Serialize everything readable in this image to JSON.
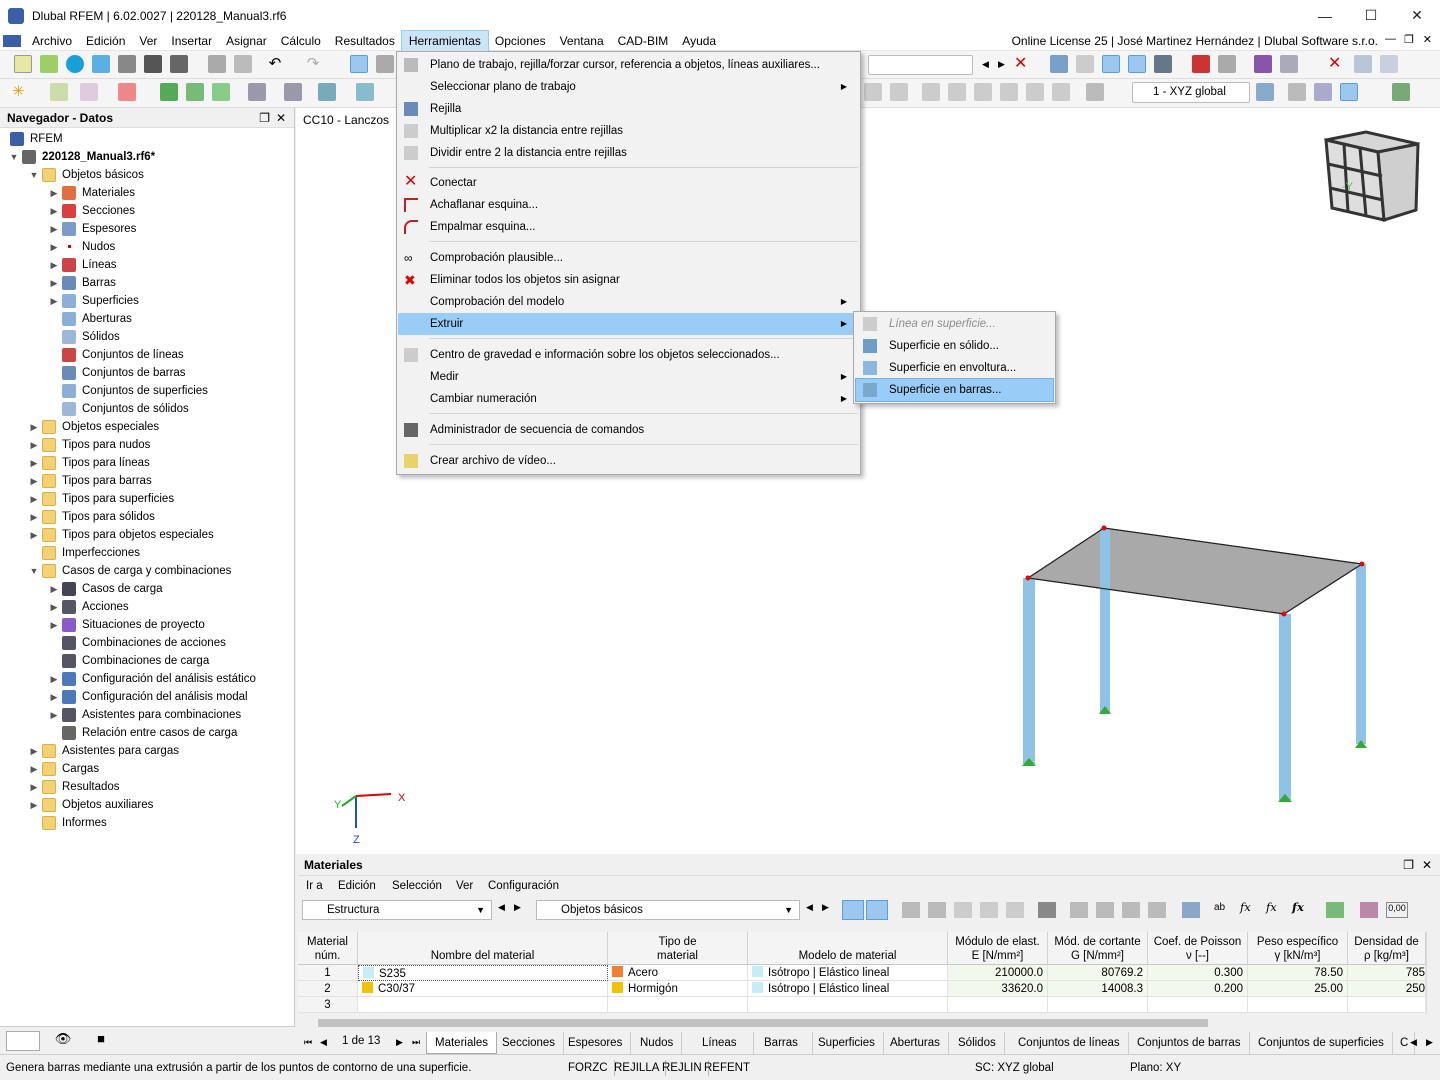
{
  "app": {
    "title": "Dlubal RFEM | 6.02.0027 | 220128_Manual3.rf6",
    "license": "Online License 25 | José Martinez Hernández | Dlubal Software s.r.o."
  },
  "menubar": [
    "Archivo",
    "Edición",
    "Ver",
    "Insertar",
    "Asignar",
    "Cálculo",
    "Resultados",
    "Herramientas",
    "Opciones",
    "Ventana",
    "CAD-BIM",
    "Ayuda"
  ],
  "toolbar": {
    "coord_system": "1 - XYZ global"
  },
  "navigator": {
    "title": "Navegador - Datos",
    "items": [
      "RFEM",
      "220128_Manual3.rf6*",
      "Objetos básicos",
      "Materiales",
      "Secciones",
      "Espesores",
      "Nudos",
      "Líneas",
      "Barras",
      "Superficies",
      "Aberturas",
      "Sólidos",
      "Conjuntos de líneas",
      "Conjuntos de barras",
      "Conjuntos de superficies",
      "Conjuntos de sólidos",
      "Objetos especiales",
      "Tipos para nudos",
      "Tipos para líneas",
      "Tipos para barras",
      "Tipos para superficies",
      "Tipos para sólidos",
      "Tipos para objetos especiales",
      "Imperfecciones",
      "Casos de carga y combinaciones",
      "Casos de carga",
      "Acciones",
      "Situaciones de proyecto",
      "Combinaciones de acciones",
      "Combinaciones de carga",
      "Configuración del análisis estático",
      "Configuración del análisis modal",
      "Asistentes para combinaciones",
      "Relación entre casos de carga",
      "Asistentes para cargas",
      "Cargas",
      "Resultados",
      "Objetos auxiliares",
      "Informes"
    ]
  },
  "viewport": {
    "label": "CC10 - Lanczos",
    "axis_x": "X",
    "axis_y": "Y",
    "axis_z": "Z",
    "cube_label": "-Y"
  },
  "menu": {
    "items": [
      "Plano de trabajo, rejilla/forzar cursor, referencia a objetos, líneas auxiliares...",
      "Seleccionar plano de trabajo",
      "Rejilla",
      "Multiplicar x2 la distancia entre rejillas",
      "Dividir entre 2 la distancia entre rejillas",
      "Conectar",
      "Achaflanar esquina...",
      "Empalmar esquina...",
      "Comprobación plausible...",
      "Eliminar todos los objetos sin asignar",
      "Comprobación del modelo",
      "Extruir",
      "Centro de gravedad e información sobre los objetos seleccionados...",
      "Medir",
      "Cambiar numeración",
      "Administrador de secuencia de comandos",
      "Crear archivo de vídeo..."
    ]
  },
  "submenu": {
    "items": [
      "Línea en superficie...",
      "Superficie en sólido...",
      "Superficie en envoltura...",
      "Superficie en barras..."
    ]
  },
  "panel": {
    "title": "Materiales",
    "menu": [
      "Ir a",
      "Edición",
      "Selección",
      "Ver",
      "Configuración"
    ],
    "combo1": "Estructura",
    "combo2": "Objetos básicos",
    "headers": [
      "Material\nnúm.",
      "Nombre del material",
      "Tipo de\nmaterial",
      "Modelo de material",
      "Módulo de elast.\nE [N/mm²]",
      "Mód. de cortante\nG [N/mm²]",
      "Coef. de Poisson\nν [--]",
      "Peso específico\nγ [kN/m³]",
      "Densidad de\nρ [kg/m³]"
    ],
    "rows": [
      {
        "num": "1",
        "name": "S235",
        "type": "Acero",
        "model": "Isótropo | Elástico lineal",
        "E": "210000.0",
        "G": "80769.2",
        "nu": "0.300",
        "gamma": "78.50",
        "rho": "785"
      },
      {
        "num": "2",
        "name": "C30/37",
        "type": "Hormigón",
        "model": "Isótropo | Elástico lineal",
        "E": "33620.0",
        "G": "14008.3",
        "nu": "0.200",
        "gamma": "25.00",
        "rho": "250"
      },
      {
        "num": "3",
        "name": "",
        "type": "",
        "model": "",
        "E": "",
        "G": "",
        "nu": "",
        "gamma": "",
        "rho": ""
      }
    ],
    "pager": "1 de 13",
    "tabs": [
      "Materiales",
      "Secciones",
      "Espesores",
      "Nudos",
      "Líneas",
      "Barras",
      "Superficies",
      "Aberturas",
      "Sólidos",
      "Conjuntos de líneas",
      "Conjuntos de barras",
      "Conjuntos de superficies",
      "C"
    ]
  },
  "status": {
    "message": "Genera barras mediante una extrusión a partir de los puntos de contorno de una superficie.",
    "toggles": [
      "FORZC",
      "REJILLA",
      "REJLIN",
      "REFENT"
    ],
    "cs": "SC: XYZ global",
    "plane": "Plano: XY"
  },
  "colors": {
    "highlight": "#99ccf6",
    "steel": "#f08030",
    "concrete": "#f2c200",
    "isotropic": "#c6ecf5"
  }
}
